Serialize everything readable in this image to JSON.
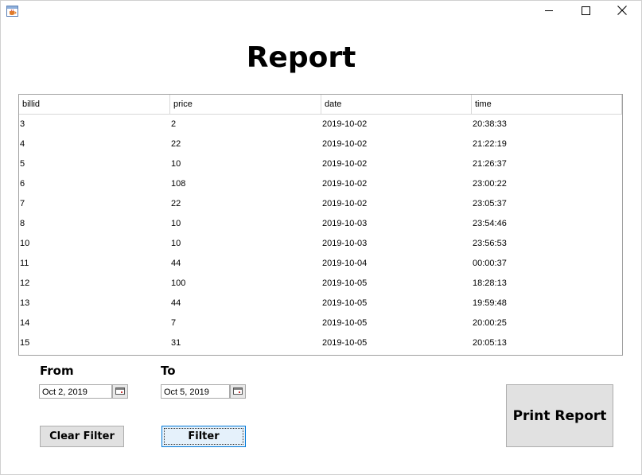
{
  "window": {
    "app_icon": "java-cup-icon",
    "controls": [
      "minimize-icon",
      "maximize-icon",
      "close-icon"
    ]
  },
  "page": {
    "title": "Report"
  },
  "table": {
    "columns": [
      "billid",
      "price",
      "date",
      "time"
    ],
    "rows": [
      [
        "3",
        "2",
        "2019-10-02",
        "20:38:33"
      ],
      [
        "4",
        "22",
        "2019-10-02",
        "21:22:19"
      ],
      [
        "5",
        "10",
        "2019-10-02",
        "21:26:37"
      ],
      [
        "6",
        "108",
        "2019-10-02",
        "23:00:22"
      ],
      [
        "7",
        "22",
        "2019-10-02",
        "23:05:37"
      ],
      [
        "8",
        "10",
        "2019-10-03",
        "23:54:46"
      ],
      [
        "10",
        "10",
        "2019-10-03",
        "23:56:53"
      ],
      [
        "11",
        "44",
        "2019-10-04",
        "00:00:37"
      ],
      [
        "12",
        "100",
        "2019-10-05",
        "18:28:13"
      ],
      [
        "13",
        "44",
        "2019-10-05",
        "19:59:48"
      ],
      [
        "14",
        "7",
        "2019-10-05",
        "20:00:25"
      ],
      [
        "15",
        "31",
        "2019-10-05",
        "20:05:13"
      ]
    ]
  },
  "filter": {
    "from_label": "From",
    "from_value": "Oct 2, 2019",
    "to_label": "To",
    "to_value": "Oct 5, 2019",
    "calendar_icon": "calendar-icon"
  },
  "buttons": {
    "clear_filter": "Clear Filter",
    "filter": "Filter",
    "print_report": "Print Report"
  }
}
